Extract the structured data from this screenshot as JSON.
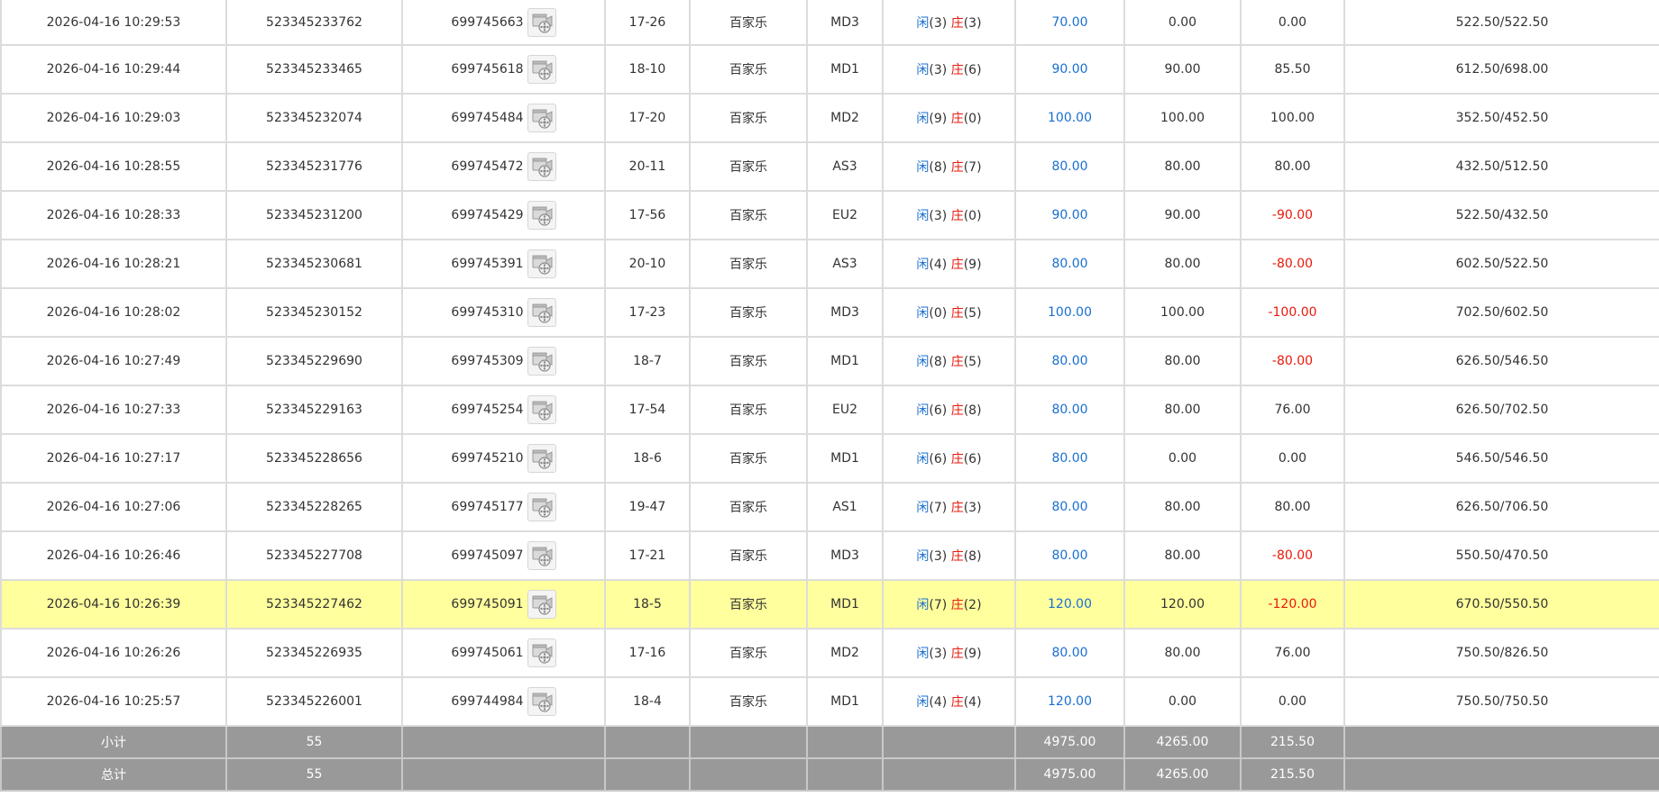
{
  "table": {
    "rows": [
      {
        "time": "2026-04-16 10:29:53",
        "bet_no": "523345233762",
        "game_no": "699745663",
        "shoe": "17-26",
        "game": "百家乐",
        "table": "MD3",
        "player": "3",
        "banker": "3",
        "bet": "70.00",
        "valid_bet": "0.00",
        "win_loss": "0.00",
        "win_loss_sign": "zero",
        "balance": "522.50/522.50",
        "highlight": false
      },
      {
        "time": "2026-04-16 10:29:44",
        "bet_no": "523345233465",
        "game_no": "699745618",
        "shoe": "18-10",
        "game": "百家乐",
        "table": "MD1",
        "player": "3",
        "banker": "6",
        "bet": "90.00",
        "valid_bet": "90.00",
        "win_loss": "85.50",
        "win_loss_sign": "pos",
        "balance": "612.50/698.00",
        "highlight": false
      },
      {
        "time": "2026-04-16 10:29:03",
        "bet_no": "523345232074",
        "game_no": "699745484",
        "shoe": "17-20",
        "game": "百家乐",
        "table": "MD2",
        "player": "9",
        "banker": "0",
        "bet": "100.00",
        "valid_bet": "100.00",
        "win_loss": "100.00",
        "win_loss_sign": "pos",
        "balance": "352.50/452.50",
        "highlight": false
      },
      {
        "time": "2026-04-16 10:28:55",
        "bet_no": "523345231776",
        "game_no": "699745472",
        "shoe": "20-11",
        "game": "百家乐",
        "table": "AS3",
        "player": "8",
        "banker": "7",
        "bet": "80.00",
        "valid_bet": "80.00",
        "win_loss": "80.00",
        "win_loss_sign": "pos",
        "balance": "432.50/512.50",
        "highlight": false
      },
      {
        "time": "2026-04-16 10:28:33",
        "bet_no": "523345231200",
        "game_no": "699745429",
        "shoe": "17-56",
        "game": "百家乐",
        "table": "EU2",
        "player": "3",
        "banker": "0",
        "bet": "90.00",
        "valid_bet": "90.00",
        "win_loss": "-90.00",
        "win_loss_sign": "neg",
        "balance": "522.50/432.50",
        "highlight": false
      },
      {
        "time": "2026-04-16 10:28:21",
        "bet_no": "523345230681",
        "game_no": "699745391",
        "shoe": "20-10",
        "game": "百家乐",
        "table": "AS3",
        "player": "4",
        "banker": "9",
        "bet": "80.00",
        "valid_bet": "80.00",
        "win_loss": "-80.00",
        "win_loss_sign": "neg",
        "balance": "602.50/522.50",
        "highlight": false
      },
      {
        "time": "2026-04-16 10:28:02",
        "bet_no": "523345230152",
        "game_no": "699745310",
        "shoe": "17-23",
        "game": "百家乐",
        "table": "MD3",
        "player": "0",
        "banker": "5",
        "bet": "100.00",
        "valid_bet": "100.00",
        "win_loss": "-100.00",
        "win_loss_sign": "neg",
        "balance": "702.50/602.50",
        "highlight": false
      },
      {
        "time": "2026-04-16 10:27:49",
        "bet_no": "523345229690",
        "game_no": "699745309",
        "shoe": "18-7",
        "game": "百家乐",
        "table": "MD1",
        "player": "8",
        "banker": "5",
        "bet": "80.00",
        "valid_bet": "80.00",
        "win_loss": "-80.00",
        "win_loss_sign": "neg",
        "balance": "626.50/546.50",
        "highlight": false
      },
      {
        "time": "2026-04-16 10:27:33",
        "bet_no": "523345229163",
        "game_no": "699745254",
        "shoe": "17-54",
        "game": "百家乐",
        "table": "EU2",
        "player": "6",
        "banker": "8",
        "bet": "80.00",
        "valid_bet": "80.00",
        "win_loss": "76.00",
        "win_loss_sign": "pos",
        "balance": "626.50/702.50",
        "highlight": false
      },
      {
        "time": "2026-04-16 10:27:17",
        "bet_no": "523345228656",
        "game_no": "699745210",
        "shoe": "18-6",
        "game": "百家乐",
        "table": "MD1",
        "player": "6",
        "banker": "6",
        "bet": "80.00",
        "valid_bet": "0.00",
        "win_loss": "0.00",
        "win_loss_sign": "zero",
        "balance": "546.50/546.50",
        "highlight": false
      },
      {
        "time": "2026-04-16 10:27:06",
        "bet_no": "523345228265",
        "game_no": "699745177",
        "shoe": "19-47",
        "game": "百家乐",
        "table": "AS1",
        "player": "7",
        "banker": "3",
        "bet": "80.00",
        "valid_bet": "80.00",
        "win_loss": "80.00",
        "win_loss_sign": "pos",
        "balance": "626.50/706.50",
        "highlight": false
      },
      {
        "time": "2026-04-16 10:26:46",
        "bet_no": "523345227708",
        "game_no": "699745097",
        "shoe": "17-21",
        "game": "百家乐",
        "table": "MD3",
        "player": "3",
        "banker": "8",
        "bet": "80.00",
        "valid_bet": "80.00",
        "win_loss": "-80.00",
        "win_loss_sign": "neg",
        "balance": "550.50/470.50",
        "highlight": false
      },
      {
        "time": "2026-04-16 10:26:39",
        "bet_no": "523345227462",
        "game_no": "699745091",
        "shoe": "18-5",
        "game": "百家乐",
        "table": "MD1",
        "player": "7",
        "banker": "2",
        "bet": "120.00",
        "valid_bet": "120.00",
        "win_loss": "-120.00",
        "win_loss_sign": "neg",
        "balance": "670.50/550.50",
        "highlight": true
      },
      {
        "time": "2026-04-16 10:26:26",
        "bet_no": "523345226935",
        "game_no": "699745061",
        "shoe": "17-16",
        "game": "百家乐",
        "table": "MD2",
        "player": "3",
        "banker": "9",
        "bet": "80.00",
        "valid_bet": "80.00",
        "win_loss": "76.00",
        "win_loss_sign": "pos",
        "balance": "750.50/826.50",
        "highlight": false
      },
      {
        "time": "2026-04-16 10:25:57",
        "bet_no": "523345226001",
        "game_no": "699744984",
        "shoe": "18-4",
        "game": "百家乐",
        "table": "MD1",
        "player": "4",
        "banker": "4",
        "bet": "120.00",
        "valid_bet": "0.00",
        "win_loss": "0.00",
        "win_loss_sign": "zero",
        "balance": "750.50/750.50",
        "highlight": false
      }
    ],
    "result_labels": {
      "player": "闲",
      "banker": "庄"
    },
    "subtotal": {
      "label": "小计",
      "count": "55",
      "bet": "4975.00",
      "valid_bet": "4265.00",
      "win_loss": "215.50"
    },
    "total": {
      "label": "总计",
      "count": "55",
      "bet": "4975.00",
      "valid_bet": "4265.00",
      "win_loss": "215.50"
    }
  },
  "icons": {
    "replay": "video-replay-icon"
  },
  "colors": {
    "player_blue": "#1a6fd1",
    "banker_red": "#e8190a",
    "highlight_row": "#ffff9e",
    "summary_bg": "#999999",
    "border": "#dcdcdc"
  }
}
